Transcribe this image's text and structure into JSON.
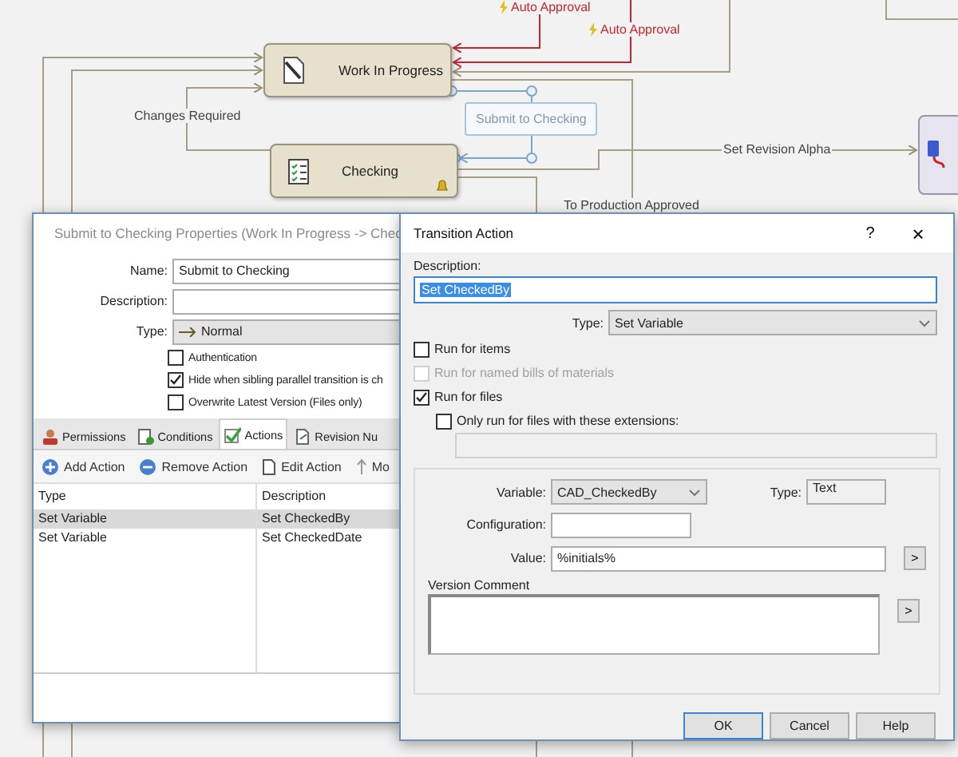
{
  "diagram": {
    "states": [
      {
        "kind": "edit",
        "label": "Work In Progress",
        "alert": false
      },
      {
        "kind": "checklist",
        "label": "Checking",
        "alert": true
      }
    ],
    "transitions": [
      {
        "kind": "auto",
        "label": "Auto Approval"
      },
      {
        "kind": "auto",
        "label": "Auto Approval"
      },
      {
        "kind": "plain",
        "label": "Changes Required"
      },
      {
        "kind": "selected",
        "label": "Submit to Checking"
      },
      {
        "kind": "plain",
        "label": "Set Revision Alpha"
      },
      {
        "kind": "plain",
        "label": "To Production Approved"
      }
    ]
  },
  "properties_dialog": {
    "title": "Submit to Checking Properties (Work In Progress -> Chec",
    "fields": [
      {
        "label": "Name:",
        "value": "Submit to Checking"
      },
      {
        "label": "Description:"
      }
    ],
    "type": {
      "label": "Type:",
      "value": "Normal"
    },
    "options": [
      {
        "label": "Authentication",
        "checked": false
      },
      {
        "label": "Hide when sibling parallel transition is ch",
        "checked": true
      },
      {
        "label": "Overwrite Latest Version (Files only)",
        "checked": false
      }
    ],
    "tabs": [
      {
        "kind": "people",
        "label": "Permissions",
        "selected": false
      },
      {
        "kind": "conditions",
        "label": "Conditions",
        "selected": false
      },
      {
        "kind": "actions",
        "label": "Actions",
        "selected": true
      },
      {
        "kind": "revision",
        "label": "Revision Nu",
        "selected": false
      }
    ],
    "toolbar": [
      {
        "kind": "add",
        "label": "Add Action"
      },
      {
        "kind": "remove",
        "label": "Remove Action"
      },
      {
        "kind": "edit",
        "label": "Edit Action"
      },
      {
        "kind": "up",
        "label": "Mo"
      }
    ],
    "table": {
      "columns": [
        "Type",
        "Description"
      ],
      "rows": [
        {
          "cells": [
            "Set Variable",
            "Set CheckedBy"
          ],
          "selected": true
        },
        {
          "cells": [
            "Set Variable",
            "Set CheckedDate"
          ],
          "selected": false
        }
      ]
    }
  },
  "action_dialog": {
    "title": "Transition Action",
    "help": "?",
    "close": "×",
    "description": {
      "label": "Description:",
      "value": "Set CheckedBy"
    },
    "type": {
      "label": "Type:",
      "value": "Set Variable"
    },
    "options": [
      {
        "label": "Run for items",
        "checked": false,
        "disabled": false,
        "indented": false
      },
      {
        "label": "Run for named bills of materials",
        "checked": false,
        "disabled": true,
        "indented": false
      },
      {
        "label": "Run for files",
        "checked": true,
        "disabled": false,
        "indented": false
      },
      {
        "label": "Only run for files with these extensions:",
        "checked": false,
        "disabled": false,
        "indented": true
      }
    ],
    "variable": {
      "label": "Variable:",
      "value": "CAD_CheckedBy"
    },
    "var_type": {
      "label": "Type:",
      "value": "Text"
    },
    "configuration": {
      "label": "Configuration:"
    },
    "value": {
      "label": "Value:",
      "value": "%initials%",
      "button": ">"
    },
    "version_comment": {
      "label": "Version Comment",
      "button": ">"
    },
    "buttons": [
      {
        "label": "OK",
        "default": true
      },
      {
        "label": "Cancel",
        "default": false
      },
      {
        "label": "Help",
        "default": false
      }
    ]
  }
}
